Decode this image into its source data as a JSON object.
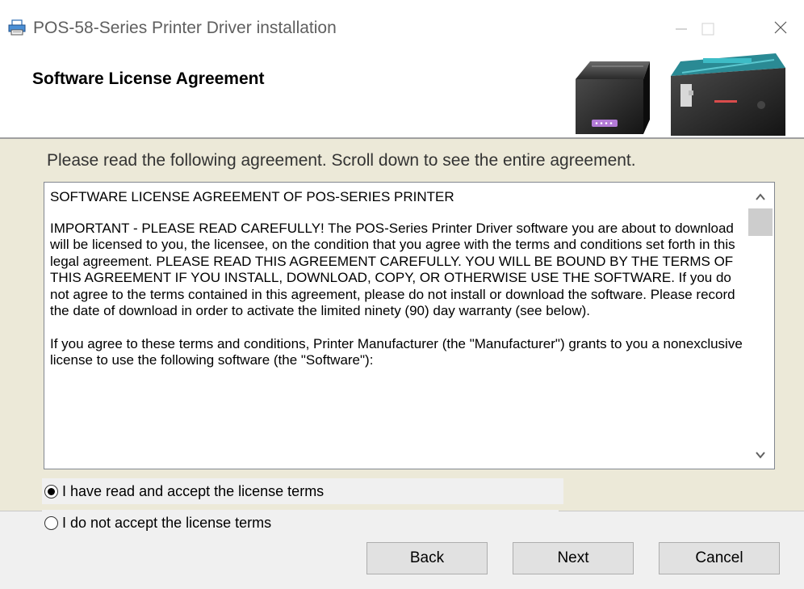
{
  "window": {
    "title": "POS-58-Series Printer Driver installation",
    "icon": "printer-icon"
  },
  "header": {
    "title": "Software License Agreement",
    "image": "thermal-printers-photo"
  },
  "instruction": "Please read the following agreement. Scroll down to see the entire agreement.",
  "license": {
    "heading": "SOFTWARE LICENSE AGREEMENT OF POS-SERIES PRINTER",
    "paragraph1": "IMPORTANT - PLEASE READ CAREFULLY! The POS-Series Printer Driver software you are about to download will be licensed to you, the licensee, on the condition that you agree with the terms and conditions set forth in this legal agreement. PLEASE READ THIS AGREEMENT CAREFULLY. YOU WILL BE BOUND BY THE TERMS OF THIS AGREEMENT IF YOU INSTALL, DOWNLOAD, COPY, OR OTHERWISE USE THE SOFTWARE. If you do not agree to the terms contained in this agreement, please do not install or download the software. Please record the date of download in order to activate the limited ninety (90) day warranty (see below).",
    "paragraph2": "If you agree to these terms and conditions, Printer Manufacturer (the \"Manufacturer\") grants to you a nonexclusive license to use the following software (the \"Software\"):"
  },
  "options": {
    "accept": {
      "label": "I have read and accept the license terms",
      "checked": true
    },
    "decline": {
      "label": "I do not accept the license terms",
      "checked": false
    }
  },
  "buttons": {
    "back": "Back",
    "next": "Next",
    "cancel": "Cancel"
  }
}
